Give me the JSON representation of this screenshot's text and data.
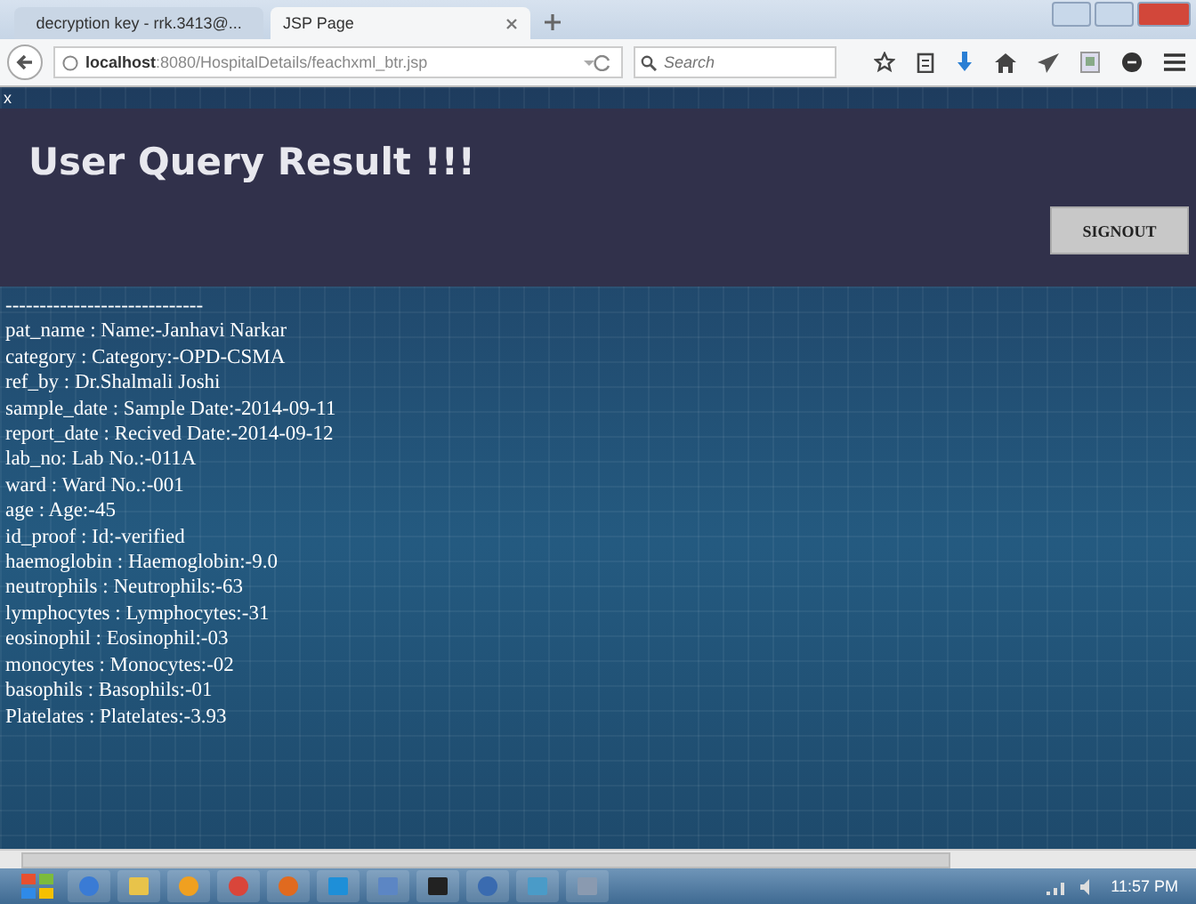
{
  "browser": {
    "tabs": [
      {
        "title": "decryption key - rrk.3413@...",
        "selected": false
      },
      {
        "title": "JSP Page",
        "selected": true
      }
    ],
    "url": "**localhost**:8080/HospitalDetails/feachxml_btr.jsp",
    "search": {
      "placeholder": "Search"
    }
  },
  "page": {
    "close_mark": "x",
    "heading": "User Query Result !!!",
    "signout": "SIGNOUT",
    "separator": "-----------------------------",
    "lines": [
      "pat_name : Name:-Janhavi Narkar",
      "category : Category:-OPD-CSMA",
      "ref_by : Dr.Shalmali Joshi",
      "sample_date : Sample Date:-2014-09-11",
      "report_date : Recived Date:-2014-09-12",
      "lab_no: Lab No.:-011A",
      "ward : Ward No.:-001",
      "age : Age:-45",
      "id_proof : Id:-verified",
      "haemoglobin : Haemoglobin:-9.0",
      "neutrophils : Neutrophils:-63",
      "lymphocytes : Lymphocytes:-31",
      "eosinophil : Eosinophil:-03",
      "monocytes : Monocytes:-02",
      "basophils : Basophils:-01",
      "Platelates : Platelates:-3.93"
    ]
  },
  "taskbar": {
    "time": "11:57 PM"
  }
}
